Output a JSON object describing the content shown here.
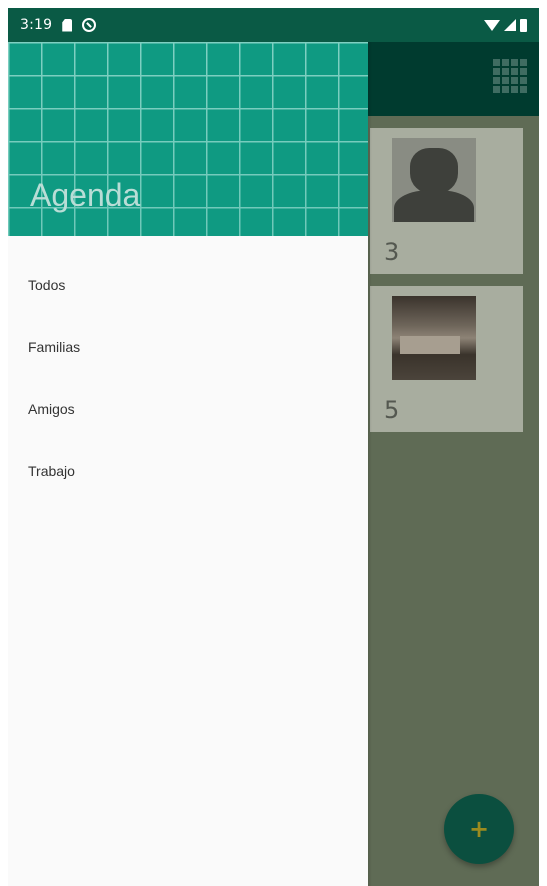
{
  "status_bar": {
    "time": "3:19"
  },
  "drawer": {
    "title": "Agenda",
    "items": [
      {
        "label": "Todos"
      },
      {
        "label": "Familias"
      },
      {
        "label": "Amigos"
      },
      {
        "label": "Trabajo"
      }
    ]
  },
  "content": {
    "cards": [
      {
        "count": "3"
      },
      {
        "count": "5"
      }
    ]
  },
  "fab": {
    "label": "+"
  },
  "colors": {
    "status_bar": "#0a5a45",
    "drawer_header": "#0f9a82",
    "fab": "#0b4f3f"
  }
}
